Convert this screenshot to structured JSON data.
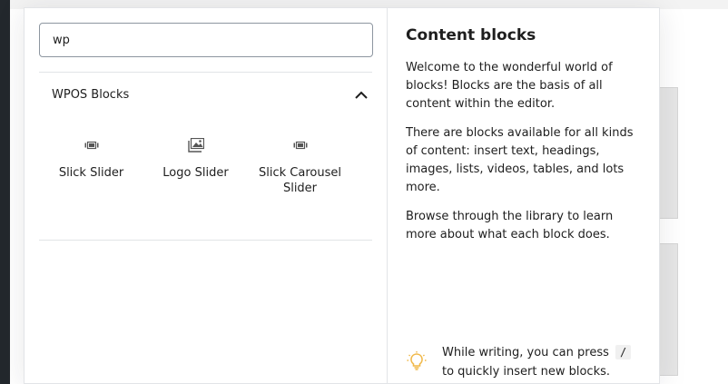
{
  "search": {
    "value": "wp"
  },
  "panel": {
    "title": "WPOS Blocks",
    "blocks": [
      {
        "label": "Slick Slider",
        "icon": "slider-icon"
      },
      {
        "label": "Logo Slider",
        "icon": "images-icon"
      },
      {
        "label": "Slick Carousel Slider",
        "icon": "slider-icon"
      }
    ]
  },
  "tips": {
    "title": "Content blocks",
    "paragraphs": [
      "Welcome to the wonderful world of blocks! Blocks are the basis of all content within the editor.",
      "There are blocks available for all kinds of content: insert text, headings, images, lists, videos, tables, and lots more.",
      "Browse through the library to learn more about what each block does."
    ],
    "bottom_before": "While writing, you can press",
    "bottom_key": "/",
    "bottom_after": "to quickly insert new blocks."
  },
  "colors": {
    "bulb": "#f0b849",
    "text": "#1e1e1e",
    "border": "#e2e4e7"
  }
}
